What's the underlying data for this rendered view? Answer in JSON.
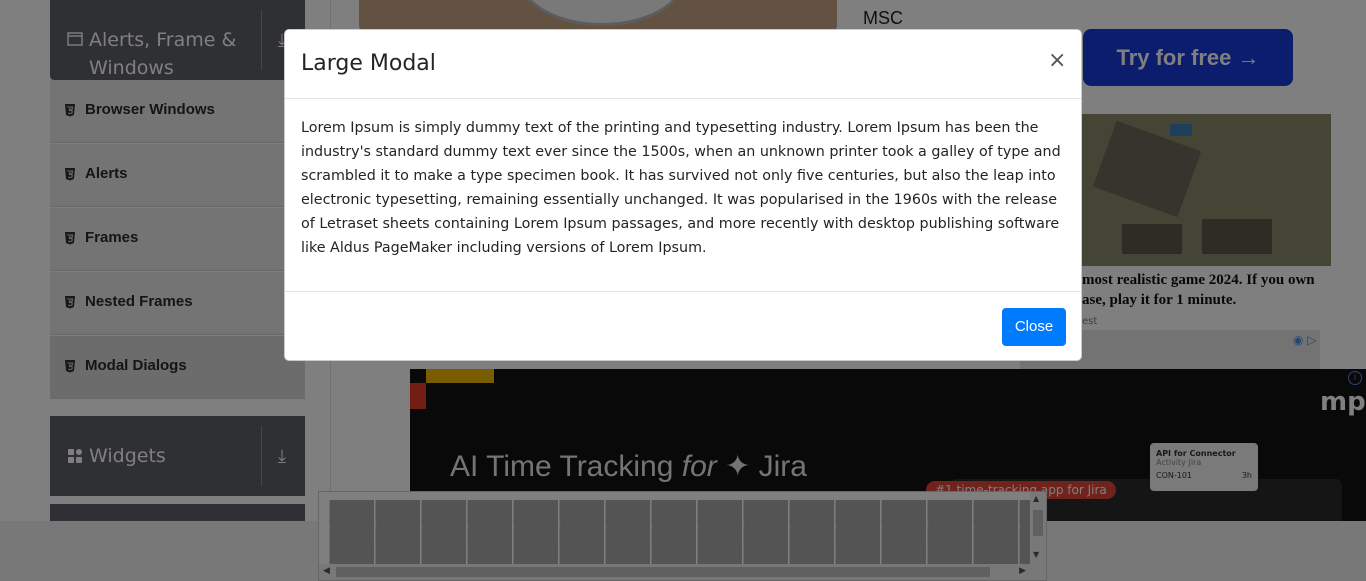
{
  "sidebar": {
    "group_alerts": {
      "label": "Alerts, Frame & Windows",
      "icon": "window-icon"
    },
    "items": [
      {
        "label": "Browser Windows",
        "icon": "html5-icon"
      },
      {
        "label": "Alerts",
        "icon": "html5-icon"
      },
      {
        "label": "Frames",
        "icon": "html5-icon"
      },
      {
        "label": "Nested Frames",
        "icon": "html5-icon"
      },
      {
        "label": "Modal Dialogs",
        "icon": "html5-icon"
      }
    ],
    "group_widgets": {
      "label": "Widgets",
      "icon": "widgets-icon"
    }
  },
  "content": {
    "msc_text": "MSC",
    "try_button": "Try for free →",
    "ad_caption": "most realistic game 2024. If you own ase, play it for 1 minute.",
    "ad_source": "est",
    "jira_banner": {
      "headline_a": "AI Time Tracking",
      "headline_b": "for",
      "headline_c": "Jira",
      "pill": "#1 time-tracking app for Jira",
      "card_title": "API for Connector",
      "card_sub": "Activity Jira",
      "card_code": "CON-101",
      "card_time": "3h",
      "partial_word": "mpo"
    }
  },
  "modal": {
    "title": "Large Modal",
    "close_symbol": "×",
    "body": "Lorem Ipsum is simply dummy text of the printing and typesetting industry. Lorem Ipsum has been the industry's standard dummy text ever since the 1500s, when an unknown printer took a galley of type and scrambled it to make a type specimen book. It has survived not only five centuries, but also the leap into electronic typesetting, remaining essentially unchanged. It was popularised in the 1960s with the release of Letraset sheets containing Lorem Ipsum passages, and more recently with desktop publishing software like Aldus PageMaker including versions of Lorem Ipsum.",
    "close_button": "Close"
  },
  "colors": {
    "primary": "#007bff",
    "sidebar_header": "#5f6168",
    "backdrop": "rgba(0,0,0,0.5)"
  }
}
